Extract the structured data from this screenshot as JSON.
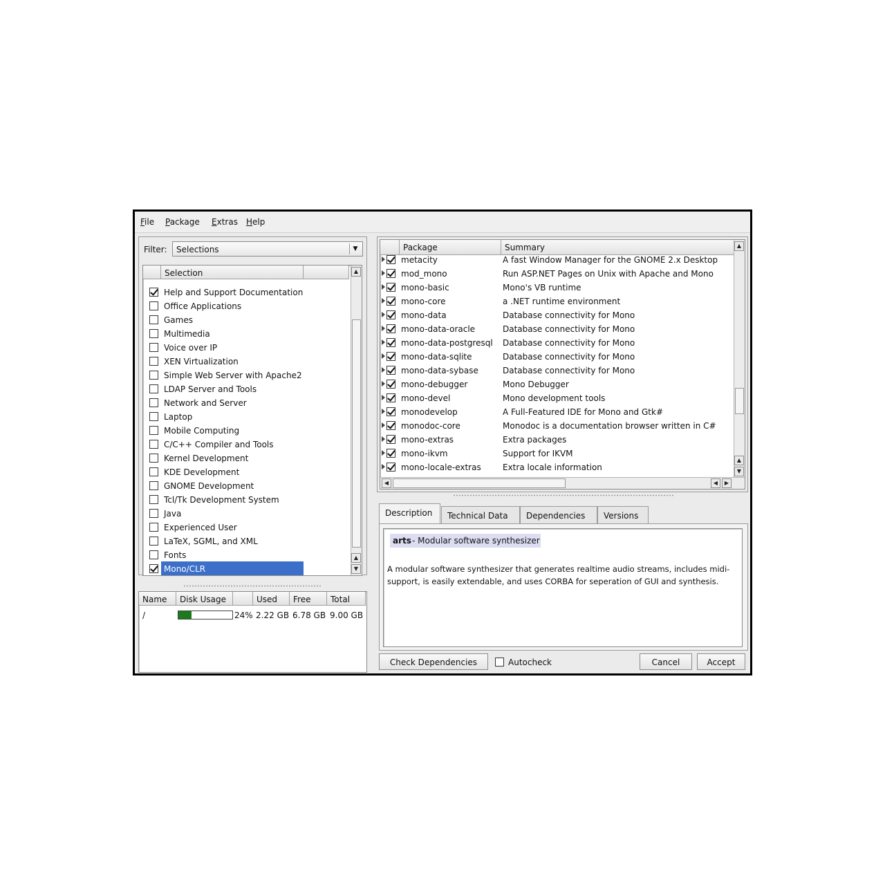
{
  "menu": [
    "File",
    "Package",
    "Extras",
    "Help"
  ],
  "filter": {
    "label": "Filter:",
    "value": "Selections"
  },
  "selection_list": {
    "header": "Selection",
    "items": [
      {
        "label": "Help and Support Documentation",
        "checked": true
      },
      {
        "label": "Office Applications",
        "checked": false
      },
      {
        "label": "Games",
        "checked": false
      },
      {
        "label": "Multimedia",
        "checked": false
      },
      {
        "label": "Voice over IP",
        "checked": false
      },
      {
        "label": "XEN Virtualization",
        "checked": false
      },
      {
        "label": "Simple Web Server with Apache2",
        "checked": false
      },
      {
        "label": "LDAP Server and Tools",
        "checked": false
      },
      {
        "label": "Network and Server",
        "checked": false
      },
      {
        "label": "Laptop",
        "checked": false
      },
      {
        "label": "Mobile Computing",
        "checked": false
      },
      {
        "label": "C/C++ Compiler and Tools",
        "checked": false
      },
      {
        "label": "Kernel Development",
        "checked": false
      },
      {
        "label": "KDE Development",
        "checked": false
      },
      {
        "label": "GNOME Development",
        "checked": false
      },
      {
        "label": "Tcl/Tk Development System",
        "checked": false
      },
      {
        "label": "Java",
        "checked": false
      },
      {
        "label": "Experienced User",
        "checked": false
      },
      {
        "label": "LaTeX, SGML, and XML",
        "checked": false
      },
      {
        "label": "Fonts",
        "checked": false
      },
      {
        "label": "Mono/CLR",
        "checked": true,
        "selected": true
      }
    ]
  },
  "disk": {
    "headers": [
      "Name",
      "Disk Usage",
      "Used",
      "Free",
      "Total"
    ],
    "rows": [
      {
        "name": "/",
        "usage_percent": 24,
        "usage_label": "24%",
        "used": "2.22 GB",
        "free": "6.78 GB",
        "total": "9.00 GB"
      }
    ]
  },
  "packages": {
    "headers": [
      "Package",
      "Summary"
    ],
    "rows": [
      {
        "name": "metacity",
        "summary": "A fast Window Manager for the GNOME 2.x Desktop",
        "checked": true
      },
      {
        "name": "mod_mono",
        "summary": "Run ASP.NET Pages on Unix with Apache and Mono",
        "checked": true
      },
      {
        "name": "mono-basic",
        "summary": "Mono's VB runtime",
        "checked": true
      },
      {
        "name": "mono-core",
        "summary": "a .NET runtime environment",
        "checked": true
      },
      {
        "name": "mono-data",
        "summary": "Database connectivity for Mono",
        "checked": true
      },
      {
        "name": "mono-data-oracle",
        "summary": "Database connectivity for Mono",
        "checked": true
      },
      {
        "name": "mono-data-postgresql",
        "summary": "Database connectivity for Mono",
        "checked": true
      },
      {
        "name": "mono-data-sqlite",
        "summary": "Database connectivity for Mono",
        "checked": true
      },
      {
        "name": "mono-data-sybase",
        "summary": "Database connectivity for Mono",
        "checked": true
      },
      {
        "name": "mono-debugger",
        "summary": "Mono Debugger",
        "checked": true
      },
      {
        "name": "mono-devel",
        "summary": "Mono development tools",
        "checked": true
      },
      {
        "name": "monodevelop",
        "summary": "A Full-Featured IDE for Mono and Gtk#",
        "checked": true
      },
      {
        "name": "monodoc-core",
        "summary": "Monodoc is a documentation browser written in C#",
        "checked": true
      },
      {
        "name": "mono-extras",
        "summary": "Extra packages",
        "checked": true
      },
      {
        "name": "mono-ikvm",
        "summary": "Support for IKVM",
        "checked": true
      },
      {
        "name": "mono-locale-extras",
        "summary": "Extra locale information",
        "checked": true
      }
    ]
  },
  "tabs": [
    "Description",
    "Technical Data",
    "Dependencies",
    "Versions"
  ],
  "description": {
    "pkg": "arts",
    "short": " - Modular software synthesizer",
    "body": "A modular software synthesizer that generates realtime audio streams, includes midi-support, is easily extendable, and uses CORBA for seperation of GUI and synthesis."
  },
  "buttons": {
    "check_deps": "Check Dependencies",
    "autocheck": "Autocheck",
    "cancel": "Cancel",
    "accept": "Accept"
  }
}
